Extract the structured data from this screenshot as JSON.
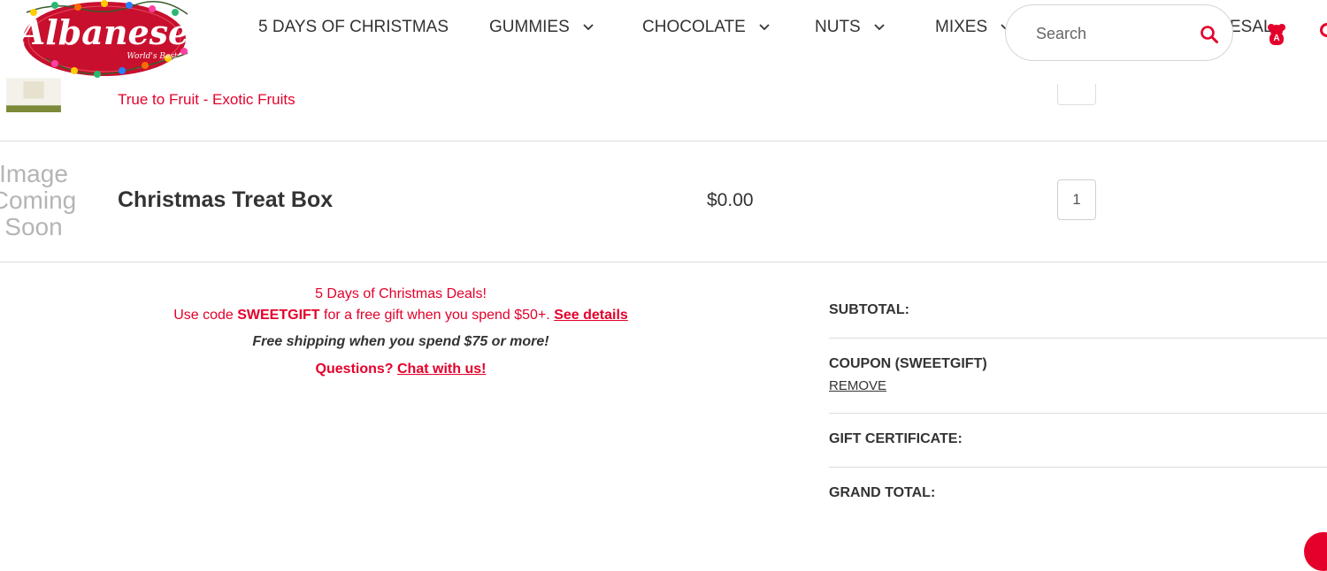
{
  "brand": {
    "logo_text": "Albanese",
    "logo_tagline": "World's Best"
  },
  "nav": {
    "items": [
      {
        "label": "5 DAYS OF CHRISTMAS",
        "has_dropdown": false
      },
      {
        "label": "GUMMIES",
        "has_dropdown": true
      },
      {
        "label": "CHOCOLATE",
        "has_dropdown": true
      },
      {
        "label": "NUTS",
        "has_dropdown": true
      },
      {
        "label": "MIXES",
        "has_dropdown": true
      }
    ],
    "wholesale_partial": "ESAL"
  },
  "search": {
    "placeholder": "Search",
    "icon": "search-icon"
  },
  "ghost_row": {
    "subtitle": "True to Fruit - Exotic Fruits"
  },
  "cart": {
    "items": [
      {
        "image_placeholder": "Image Coming Soon",
        "name": "Christmas Treat Box",
        "price": "$0.00",
        "quantity": "1"
      }
    ]
  },
  "promo": {
    "heading": "5 Days of Christmas Deals!",
    "code_prefix": "Use code ",
    "code": "SWEETGIFT",
    "code_suffix": " for a free gift when you spend $50+. ",
    "details_link": "See details",
    "shipping_note": "Free shipping when you spend $75 or more!",
    "questions": "Questions? ",
    "chat_link": "Chat with us!"
  },
  "totals": {
    "subtotal_label": "SUBTOTAL:",
    "coupon_label": "COUPON (SWEETGIFT)",
    "remove_label": "REMOVE",
    "gift_label": "GIFT CERTIFICATE:",
    "grand_label": "GRAND TOTAL:"
  },
  "colors": {
    "brand_red": "#e4002b",
    "text": "#333333",
    "divider": "#dcdcdc"
  }
}
